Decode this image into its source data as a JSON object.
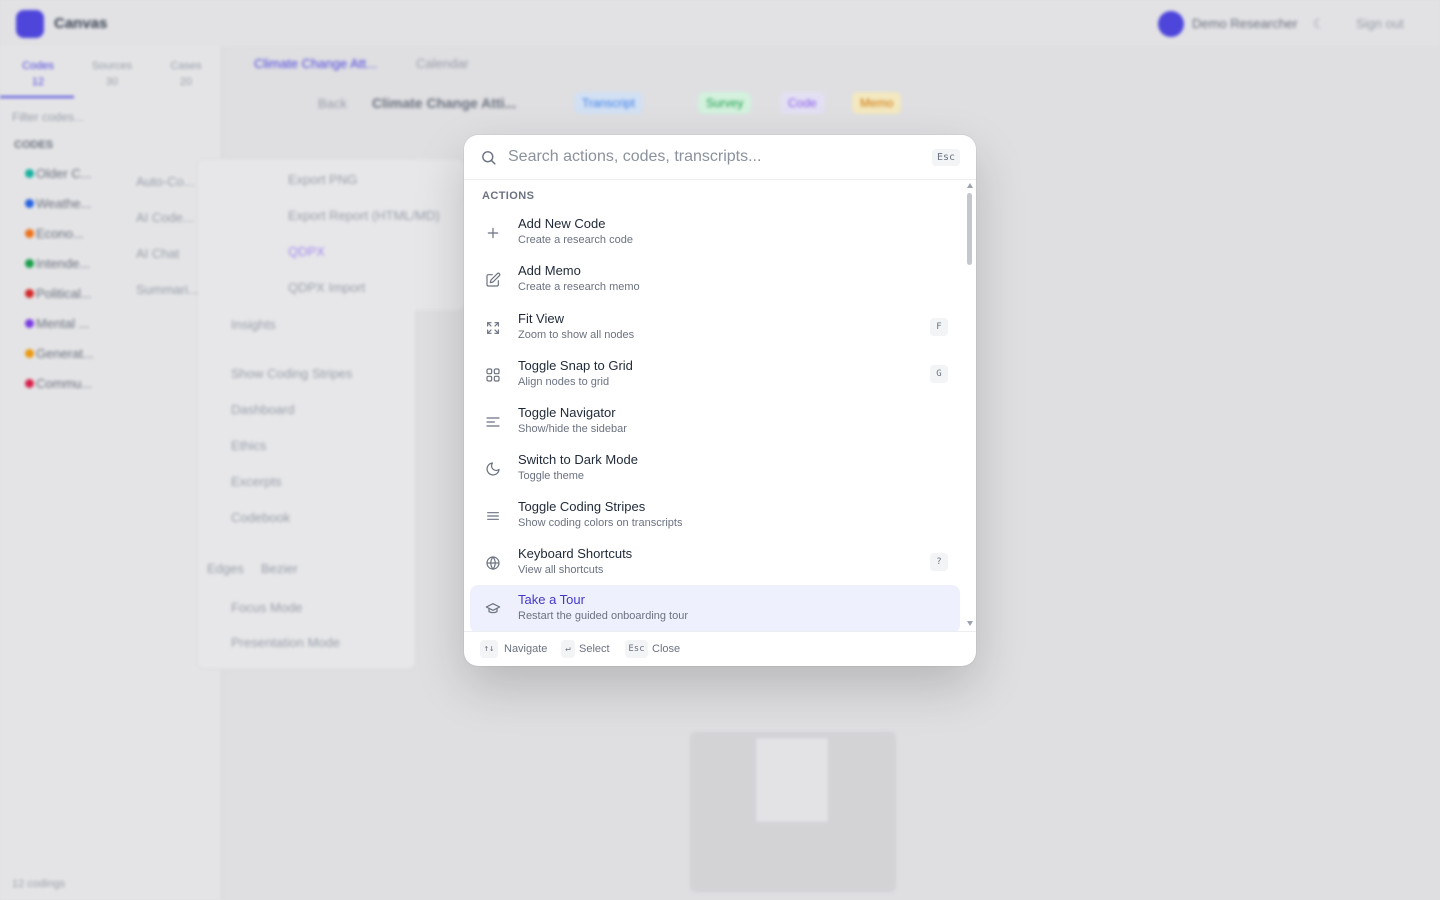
{
  "background": {
    "app_name": "Canvas",
    "user_name": "Demo Researcher",
    "sign_out": "Sign out",
    "sidebar_tabs": [
      {
        "label": "Codes",
        "count": "12"
      },
      {
        "label": "Sources",
        "count": "30"
      },
      {
        "label": "Cases",
        "count": "20"
      }
    ],
    "filter_placeholder": "Filter codes...",
    "codes_heading": "CODES",
    "codes": [
      {
        "label": "Older C...",
        "color": "#14b8a6"
      },
      {
        "label": "Weathe...",
        "color": "#2563eb"
      },
      {
        "label": "Econo...",
        "color": "#f97316"
      },
      {
        "label": "Intende...",
        "color": "#16a34a"
      },
      {
        "label": "Political...",
        "color": "#dc2626"
      },
      {
        "label": "Mental ...",
        "color": "#7c3aed"
      },
      {
        "label": "Generat...",
        "color": "#f59e0b"
      },
      {
        "label": "Commu...",
        "color": "#e11d48"
      }
    ],
    "sidebar_footer": "12 codings",
    "canvas_tabs": [
      "Climate Change Att...",
      "Calendar"
    ],
    "canvas_title": "Climate Change Atti...",
    "back_label": "Back",
    "chips": [
      {
        "label": "Transcript",
        "color": "#3b82f6"
      },
      {
        "label": "Survey",
        "color": "#16a34a"
      },
      {
        "label": "Code",
        "color": "#8b5cf6"
      },
      {
        "label": "Memo",
        "color": "#d97706"
      }
    ],
    "dropdown_items": [
      "Auto-Co...",
      "AI Code...",
      "AI Chat",
      "Summari...",
      "Insights",
      "Show Coding Stripes",
      "Dashboard",
      "Ethics",
      "Excerpts",
      "Codebook",
      "Focus Mode",
      "Presentation Mode"
    ],
    "dropdown_edges_label": "Edges",
    "dropdown_edges_value": "Bezier",
    "export_items": [
      "Export PNG",
      "Export Report (HTML/MD)",
      "QDPX",
      "QDPX Import"
    ]
  },
  "palette": {
    "search_placeholder": "Search actions, codes, transcripts...",
    "esc_label": "Esc",
    "section_label": "ACTIONS",
    "items": [
      {
        "title": "Add New Code",
        "subtitle": "Create a research code",
        "icon": "plus-icon",
        "shortcut": ""
      },
      {
        "title": "Add Memo",
        "subtitle": "Create a research memo",
        "icon": "edit-icon",
        "shortcut": ""
      },
      {
        "title": "Fit View",
        "subtitle": "Zoom to show all nodes",
        "icon": "fullscreen-icon",
        "shortcut": "F"
      },
      {
        "title": "Toggle Snap to Grid",
        "subtitle": "Align nodes to grid",
        "icon": "grid-icon",
        "shortcut": "G"
      },
      {
        "title": "Toggle Navigator",
        "subtitle": "Show/hide the sidebar",
        "icon": "align-left-icon",
        "shortcut": ""
      },
      {
        "title": "Switch to Dark Mode",
        "subtitle": "Toggle theme",
        "icon": "moon-icon",
        "shortcut": ""
      },
      {
        "title": "Toggle Coding Stripes",
        "subtitle": "Show coding colors on transcripts",
        "icon": "menu-lines-icon",
        "shortcut": ""
      },
      {
        "title": "Keyboard Shortcuts",
        "subtitle": "View all shortcuts",
        "icon": "globe-icon",
        "shortcut": "?"
      },
      {
        "title": "Take a Tour",
        "subtitle": "Restart the guided onboarding tour",
        "icon": "graduation-cap-icon",
        "shortcut": ""
      }
    ],
    "footer": {
      "navigate_key": "↑↓",
      "navigate_label": "Navigate",
      "select_key": "↵",
      "select_label": "Select",
      "close_key": "Esc",
      "close_label": "Close"
    }
  }
}
